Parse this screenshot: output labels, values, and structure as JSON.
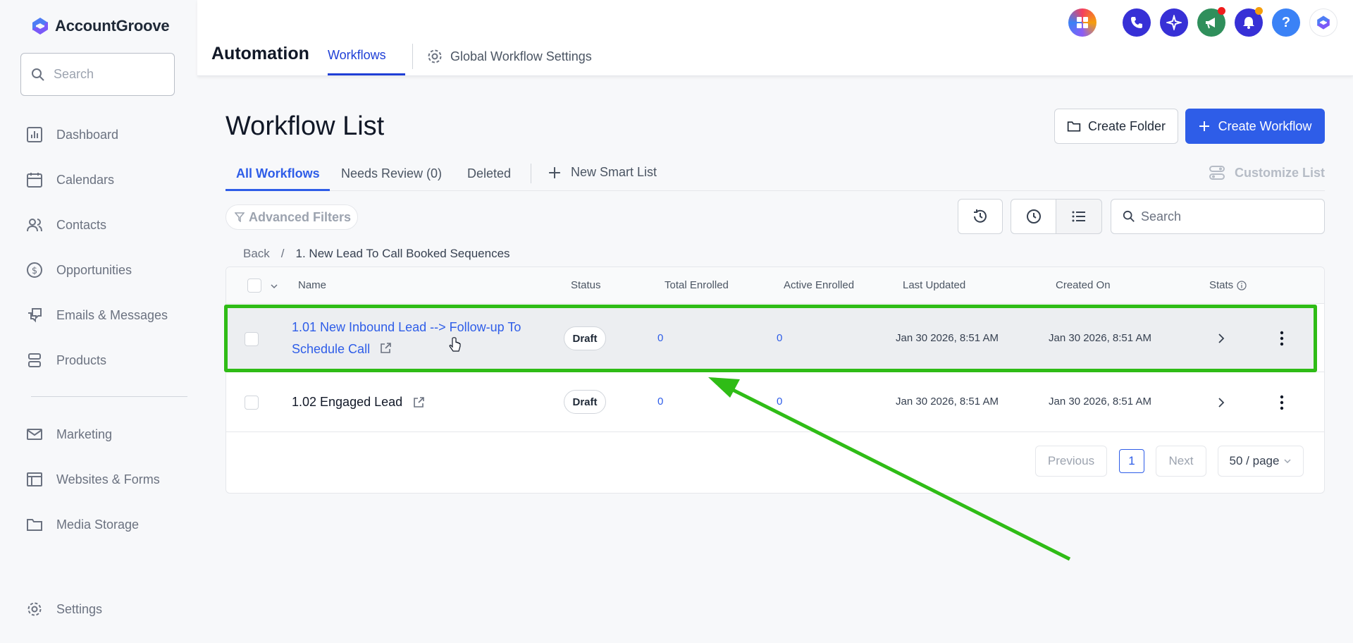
{
  "app": {
    "name": "AccountGroove"
  },
  "sidebar": {
    "search_placeholder": "Search",
    "items": [
      {
        "label": "Dashboard",
        "icon": "chart-icon"
      },
      {
        "label": "Calendars",
        "icon": "calendar-icon"
      },
      {
        "label": "Contacts",
        "icon": "contacts-icon"
      },
      {
        "label": "Opportunities",
        "icon": "dollar-icon"
      },
      {
        "label": "Emails & Messages",
        "icon": "messages-icon"
      },
      {
        "label": "Products",
        "icon": "products-icon"
      },
      {
        "label": "Marketing",
        "icon": "mail-icon"
      },
      {
        "label": "Websites & Forms",
        "icon": "browser-icon"
      },
      {
        "label": "Media Storage",
        "icon": "folder-icon"
      },
      {
        "label": "Settings",
        "icon": "gear-icon"
      }
    ]
  },
  "header": {
    "title": "Automation",
    "tab_workflows": "Workflows",
    "tab_global": "Global Workflow Settings",
    "help_label": "?"
  },
  "main": {
    "title": "Workflow List",
    "create_folder": "Create Folder",
    "create_workflow": "Create Workflow",
    "tabs": [
      "All Workflows",
      "Needs Review (0)",
      "Deleted"
    ],
    "new_smart_list": "New Smart List",
    "customize_list": "Customize List",
    "advanced_filters": "Advanced Filters",
    "search_placeholder": "Search",
    "breadcrumb": {
      "back": "Back",
      "separator": "/",
      "current": "1. New Lead To Call Booked Sequences"
    }
  },
  "table": {
    "columns": [
      "Name",
      "Status",
      "Total Enrolled",
      "Active Enrolled",
      "Last Updated",
      "Created On",
      "Stats"
    ],
    "rows": [
      {
        "name": "1.01 New Inbound Lead --> Follow-up To Schedule Call",
        "status": "Draft",
        "total": "0",
        "active": "0",
        "updated": "Jan 30 2026, 8:51 AM",
        "created": "Jan 30 2026, 8:51 AM"
      },
      {
        "name": "1.02 Engaged Lead",
        "status": "Draft",
        "total": "0",
        "active": "0",
        "updated": "Jan 30 2026, 8:51 AM",
        "created": "Jan 30 2026, 8:51 AM"
      }
    ]
  },
  "pagination": {
    "previous": "Previous",
    "page": "1",
    "next": "Next",
    "page_size": "50 / page"
  },
  "colors": {
    "accent": "#2e5de8",
    "highlight": "#2fbc16"
  }
}
